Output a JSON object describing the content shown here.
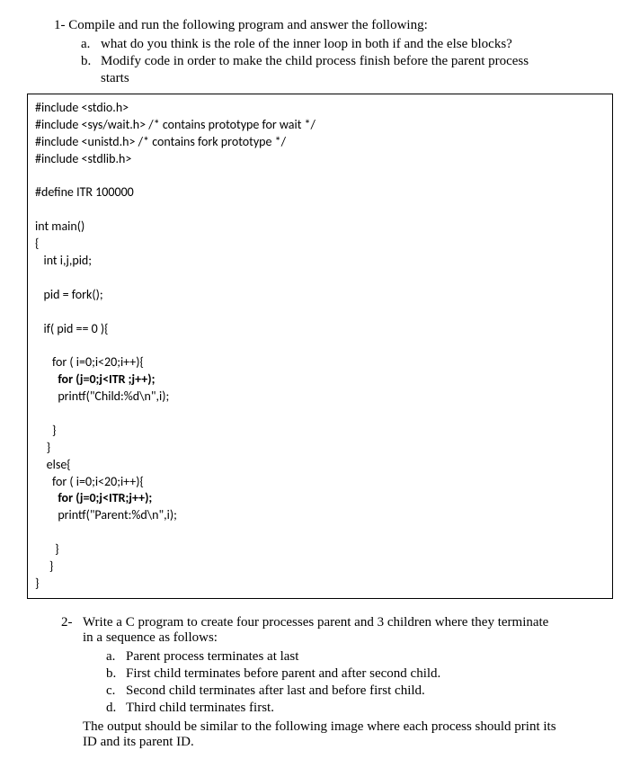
{
  "q1": {
    "number": "1-",
    "text": "Compile and run the following program and answer the following:",
    "a_label": "a.",
    "a_text": "what do you think is the role of the inner loop in both if and the else blocks?",
    "b_label": "b.",
    "b_text": "Modify code in order to make the child process finish before the parent process",
    "b_text2": "starts"
  },
  "code": {
    "l1": "#include <stdio.h>",
    "l2": "#include <sys/wait.h> /* contains prototype for wait */",
    "l3": "#include <unistd.h> /* contains fork prototype */",
    "l4": "#include <stdlib.h>",
    "l5": "",
    "l6": "#define ITR 100000",
    "l7": "",
    "l8": "int main()",
    "l9": "{",
    "l10": "   int i,j,pid;",
    "l11": "",
    "l12": "   pid = fork();",
    "l13": "",
    "l14": "   if( pid == 0 ){",
    "l15": "",
    "l16": "      for ( i=0;i<20;i++){",
    "l17": "        for (j=0;j<ITR ;j++);",
    "l18": "        printf(\"Child:%d\\n\",i);",
    "l19": "",
    "l20": "      }",
    "l21": "    }",
    "l22": "    else{",
    "l23": "      for ( i=0;i<20;i++){",
    "l24": "        for (j=0;j<ITR;j++);",
    "l25": "        printf(\"Parent:%d\\n\",i);",
    "l26": "",
    "l27": "       }",
    "l28": "     }",
    "l29": "}"
  },
  "q2": {
    "number": "2-",
    "text1": "Write a C program to create four processes parent and 3 children where they terminate",
    "text2": "in a sequence as follows:",
    "a_label": "a.",
    "a_text": "Parent process terminates at last",
    "b_label": "b.",
    "b_text": "First child terminates before parent and after second child.",
    "c_label": "c.",
    "c_text": "Second child terminates after last and before first child.",
    "d_label": "d.",
    "d_text": "Third child terminates first.",
    "tail1": "The output should be similar to the following image where each process should print its",
    "tail2": "ID and its parent ID."
  }
}
